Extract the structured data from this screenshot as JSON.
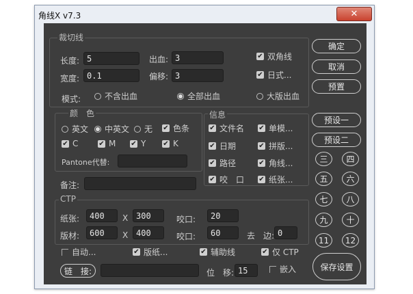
{
  "window": {
    "title": "角线X v7.3",
    "close_label": "✕"
  },
  "cut": {
    "legend": "裁切线",
    "length_label": "长度:",
    "length_value": "5",
    "width_label": "宽度:",
    "width_value": "0.1",
    "bleed_label": "出血:",
    "bleed_value": "3",
    "offset_label": "偏移:",
    "offset_value": "3",
    "mode_label": "模式:",
    "mode_options": [
      "不含出血",
      "全部出血",
      "大版出血"
    ],
    "mode_selected": "全部出血",
    "double_corner_label": "双角线",
    "japanese_label": "日式..."
  },
  "color": {
    "legend": "颜　色",
    "lang_options": [
      "英文",
      "中英文",
      "无"
    ],
    "lang_selected": "中英文",
    "color_bar_label": "色条",
    "channels": [
      "C",
      "M",
      "Y",
      "K"
    ],
    "pantone_label": "Pantone代替:"
  },
  "info": {
    "legend": "信息",
    "items": [
      "文件名",
      "单模...",
      "日期",
      "拼版...",
      "路径",
      "角线...",
      "咬　口",
      "纸张..."
    ]
  },
  "note": {
    "label": "备注:"
  },
  "ctp": {
    "legend": "CTP",
    "paper_label": "纸张:",
    "paper_w": "400",
    "paper_h": "300",
    "plate_label": "版材:",
    "plate_w": "600",
    "plate_h": "400",
    "x_label": "X",
    "bite1_label": "咬口:",
    "bite1_value": "20",
    "bite2_label": "咬口:",
    "bite2_value": "60",
    "trim_label": "去　边:",
    "trim_value": "0",
    "auto_label": "自动...",
    "layout_label": "版纸...",
    "aux_label": "辅助线",
    "only_ctp_label": "仅 CTP",
    "link_label": "链　接:",
    "shift_label": "位　移:",
    "shift_value": "15",
    "embed_label": "嵌入"
  },
  "buttons": {
    "ok": "确定",
    "cancel": "取消",
    "preset": "预置",
    "preset1": "预设一",
    "preset2": "预设二",
    "numbers": [
      "三",
      "四",
      "五",
      "六",
      "七",
      "八",
      "九",
      "十",
      "11",
      "12"
    ],
    "save": "保存设置"
  }
}
